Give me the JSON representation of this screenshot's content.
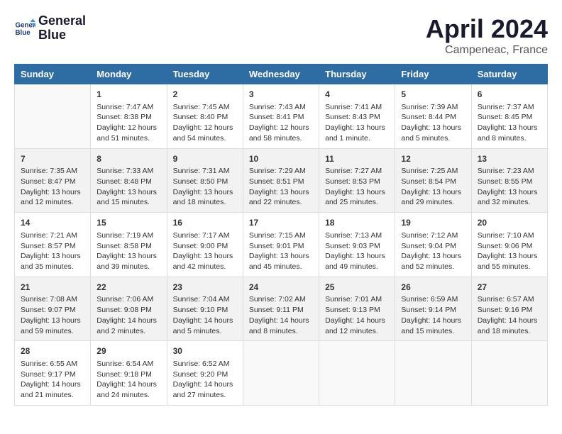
{
  "logo": {
    "line1": "General",
    "line2": "Blue"
  },
  "title": "April 2024",
  "subtitle": "Campeneac, France",
  "days_header": [
    "Sunday",
    "Monday",
    "Tuesday",
    "Wednesday",
    "Thursday",
    "Friday",
    "Saturday"
  ],
  "weeks": [
    [
      {
        "day": "",
        "content": ""
      },
      {
        "day": "1",
        "content": "Sunrise: 7:47 AM\nSunset: 8:38 PM\nDaylight: 12 hours\nand 51 minutes."
      },
      {
        "day": "2",
        "content": "Sunrise: 7:45 AM\nSunset: 8:40 PM\nDaylight: 12 hours\nand 54 minutes."
      },
      {
        "day": "3",
        "content": "Sunrise: 7:43 AM\nSunset: 8:41 PM\nDaylight: 12 hours\nand 58 minutes."
      },
      {
        "day": "4",
        "content": "Sunrise: 7:41 AM\nSunset: 8:43 PM\nDaylight: 13 hours\nand 1 minute."
      },
      {
        "day": "5",
        "content": "Sunrise: 7:39 AM\nSunset: 8:44 PM\nDaylight: 13 hours\nand 5 minutes."
      },
      {
        "day": "6",
        "content": "Sunrise: 7:37 AM\nSunset: 8:45 PM\nDaylight: 13 hours\nand 8 minutes."
      }
    ],
    [
      {
        "day": "7",
        "content": "Sunrise: 7:35 AM\nSunset: 8:47 PM\nDaylight: 13 hours\nand 12 minutes."
      },
      {
        "day": "8",
        "content": "Sunrise: 7:33 AM\nSunset: 8:48 PM\nDaylight: 13 hours\nand 15 minutes."
      },
      {
        "day": "9",
        "content": "Sunrise: 7:31 AM\nSunset: 8:50 PM\nDaylight: 13 hours\nand 18 minutes."
      },
      {
        "day": "10",
        "content": "Sunrise: 7:29 AM\nSunset: 8:51 PM\nDaylight: 13 hours\nand 22 minutes."
      },
      {
        "day": "11",
        "content": "Sunrise: 7:27 AM\nSunset: 8:53 PM\nDaylight: 13 hours\nand 25 minutes."
      },
      {
        "day": "12",
        "content": "Sunrise: 7:25 AM\nSunset: 8:54 PM\nDaylight: 13 hours\nand 29 minutes."
      },
      {
        "day": "13",
        "content": "Sunrise: 7:23 AM\nSunset: 8:55 PM\nDaylight: 13 hours\nand 32 minutes."
      }
    ],
    [
      {
        "day": "14",
        "content": "Sunrise: 7:21 AM\nSunset: 8:57 PM\nDaylight: 13 hours\nand 35 minutes."
      },
      {
        "day": "15",
        "content": "Sunrise: 7:19 AM\nSunset: 8:58 PM\nDaylight: 13 hours\nand 39 minutes."
      },
      {
        "day": "16",
        "content": "Sunrise: 7:17 AM\nSunset: 9:00 PM\nDaylight: 13 hours\nand 42 minutes."
      },
      {
        "day": "17",
        "content": "Sunrise: 7:15 AM\nSunset: 9:01 PM\nDaylight: 13 hours\nand 45 minutes."
      },
      {
        "day": "18",
        "content": "Sunrise: 7:13 AM\nSunset: 9:03 PM\nDaylight: 13 hours\nand 49 minutes."
      },
      {
        "day": "19",
        "content": "Sunrise: 7:12 AM\nSunset: 9:04 PM\nDaylight: 13 hours\nand 52 minutes."
      },
      {
        "day": "20",
        "content": "Sunrise: 7:10 AM\nSunset: 9:06 PM\nDaylight: 13 hours\nand 55 minutes."
      }
    ],
    [
      {
        "day": "21",
        "content": "Sunrise: 7:08 AM\nSunset: 9:07 PM\nDaylight: 13 hours\nand 59 minutes."
      },
      {
        "day": "22",
        "content": "Sunrise: 7:06 AM\nSunset: 9:08 PM\nDaylight: 14 hours\nand 2 minutes."
      },
      {
        "day": "23",
        "content": "Sunrise: 7:04 AM\nSunset: 9:10 PM\nDaylight: 14 hours\nand 5 minutes."
      },
      {
        "day": "24",
        "content": "Sunrise: 7:02 AM\nSunset: 9:11 PM\nDaylight: 14 hours\nand 8 minutes."
      },
      {
        "day": "25",
        "content": "Sunrise: 7:01 AM\nSunset: 9:13 PM\nDaylight: 14 hours\nand 12 minutes."
      },
      {
        "day": "26",
        "content": "Sunrise: 6:59 AM\nSunset: 9:14 PM\nDaylight: 14 hours\nand 15 minutes."
      },
      {
        "day": "27",
        "content": "Sunrise: 6:57 AM\nSunset: 9:16 PM\nDaylight: 14 hours\nand 18 minutes."
      }
    ],
    [
      {
        "day": "28",
        "content": "Sunrise: 6:55 AM\nSunset: 9:17 PM\nDaylight: 14 hours\nand 21 minutes."
      },
      {
        "day": "29",
        "content": "Sunrise: 6:54 AM\nSunset: 9:18 PM\nDaylight: 14 hours\nand 24 minutes."
      },
      {
        "day": "30",
        "content": "Sunrise: 6:52 AM\nSunset: 9:20 PM\nDaylight: 14 hours\nand 27 minutes."
      },
      {
        "day": "",
        "content": ""
      },
      {
        "day": "",
        "content": ""
      },
      {
        "day": "",
        "content": ""
      },
      {
        "day": "",
        "content": ""
      }
    ]
  ]
}
